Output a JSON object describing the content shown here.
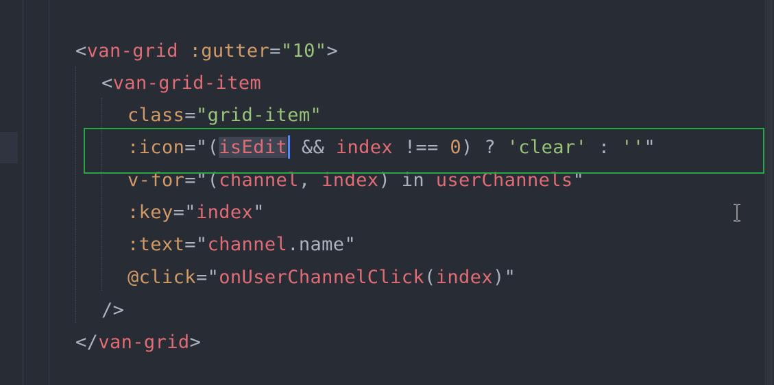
{
  "editor": {
    "lines": [
      [
        {
          "t": "<",
          "c": "tok-punct"
        },
        {
          "t": "van-grid",
          "c": "tok-tag"
        },
        {
          "t": " ",
          "c": "tok-plain"
        },
        {
          "t": ":gutter",
          "c": "tok-attr"
        },
        {
          "t": "=",
          "c": "tok-punct"
        },
        {
          "t": "\"10\"",
          "c": "tok-str"
        },
        {
          "t": ">",
          "c": "tok-punct"
        }
      ],
      [
        {
          "t": "<",
          "c": "tok-punct"
        },
        {
          "t": "van-grid-item",
          "c": "tok-tag"
        }
      ],
      [
        {
          "t": "class",
          "c": "tok-attr"
        },
        {
          "t": "=",
          "c": "tok-punct"
        },
        {
          "t": "\"grid-item\"",
          "c": "tok-str"
        }
      ],
      [
        {
          "t": ":icon",
          "c": "tok-attr"
        },
        {
          "t": "=\"(",
          "c": "tok-punct"
        },
        {
          "t": "isEdit",
          "c": "tok-var",
          "selected": true,
          "cursor": true
        },
        {
          "t": " && ",
          "c": "tok-plain"
        },
        {
          "t": "index",
          "c": "tok-var"
        },
        {
          "t": " !== ",
          "c": "tok-plain"
        },
        {
          "t": "0",
          "c": "tok-num"
        },
        {
          "t": ") ? ",
          "c": "tok-plain"
        },
        {
          "t": "'clear'",
          "c": "tok-str"
        },
        {
          "t": " : ",
          "c": "tok-plain"
        },
        {
          "t": "''",
          "c": "tok-str"
        },
        {
          "t": "\"",
          "c": "tok-punct"
        }
      ],
      [
        {
          "t": "v-for",
          "c": "tok-attr"
        },
        {
          "t": "=\"(",
          "c": "tok-punct"
        },
        {
          "t": "channel",
          "c": "tok-var"
        },
        {
          "t": ", ",
          "c": "tok-plain"
        },
        {
          "t": "index",
          "c": "tok-var"
        },
        {
          "t": ") ",
          "c": "tok-plain"
        },
        {
          "t": "in",
          "c": "tok-plain"
        },
        {
          "t": " ",
          "c": "tok-plain"
        },
        {
          "t": "userChannels",
          "c": "tok-var"
        },
        {
          "t": "\"",
          "c": "tok-punct"
        }
      ],
      [
        {
          "t": ":key",
          "c": "tok-attr"
        },
        {
          "t": "=\"",
          "c": "tok-punct"
        },
        {
          "t": "index",
          "c": "tok-var"
        },
        {
          "t": "\"",
          "c": "tok-punct"
        }
      ],
      [
        {
          "t": ":text",
          "c": "tok-attr"
        },
        {
          "t": "=\"",
          "c": "tok-punct"
        },
        {
          "t": "channel",
          "c": "tok-var"
        },
        {
          "t": ".",
          "c": "tok-plain"
        },
        {
          "t": "name",
          "c": "tok-plain"
        },
        {
          "t": "\"",
          "c": "tok-punct"
        }
      ],
      [
        {
          "t": "@click",
          "c": "tok-attr"
        },
        {
          "t": "=\"",
          "c": "tok-punct"
        },
        {
          "t": "onUserChannelClick",
          "c": "tok-var"
        },
        {
          "t": "(",
          "c": "tok-plain"
        },
        {
          "t": "index",
          "c": "tok-var"
        },
        {
          "t": ")",
          "c": "tok-plain"
        },
        {
          "t": "\"",
          "c": "tok-punct"
        }
      ],
      [
        {
          "t": "/>",
          "c": "tok-punct"
        }
      ],
      [
        {
          "t": "</",
          "c": "tok-punct"
        },
        {
          "t": "van-grid",
          "c": "tok-tag"
        },
        {
          "t": ">",
          "c": "tok-punct"
        }
      ]
    ]
  },
  "colors": {
    "background": "#282c34",
    "highlight_box": "#27a844",
    "cursor": "#528bff",
    "tag": "#e06c75",
    "attribute": "#d19a66",
    "string": "#98c379"
  },
  "icons": {
    "mouse_pointer": "text-cursor-ibeam-icon"
  }
}
